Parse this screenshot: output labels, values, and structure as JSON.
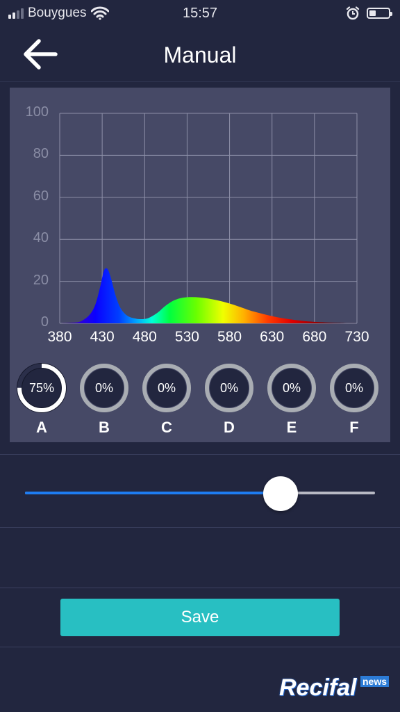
{
  "status_bar": {
    "carrier": "Bouygues",
    "time": "15:57",
    "battery_level": 0.35
  },
  "nav": {
    "title": "Manual",
    "back_icon": "arrow-left-icon"
  },
  "chart_data": {
    "type": "area",
    "title": "",
    "xlabel": "",
    "ylabel": "",
    "xlim": [
      380,
      730
    ],
    "ylim": [
      0,
      100
    ],
    "x_ticks": [
      "380",
      "430",
      "480",
      "530",
      "580",
      "630",
      "680",
      "730"
    ],
    "y_ticks": [
      "100",
      "80",
      "60",
      "40",
      "20",
      "0"
    ],
    "grid": true,
    "fill": "visible-spectrum-gradient",
    "series": [
      {
        "x": [
          380,
          395,
          405,
          415,
          422,
          428,
          432,
          436,
          440,
          446,
          452,
          460,
          470,
          478,
          485,
          495,
          505,
          515,
          525,
          535,
          545,
          555,
          565,
          575,
          585,
          595,
          605,
          620,
          635,
          650,
          665,
          680,
          700,
          715,
          730
        ],
        "y": [
          0,
          0.3,
          1,
          4,
          9,
          18,
          25,
          26,
          22,
          13,
          7,
          3.5,
          2.2,
          2,
          2.6,
          5,
          8.5,
          11,
          12.2,
          12.5,
          12.3,
          11.8,
          11,
          10,
          8.8,
          7.4,
          6,
          4.4,
          3,
          2,
          1.2,
          0.7,
          0.3,
          0.1,
          0
        ]
      }
    ]
  },
  "channels": [
    {
      "label": "A",
      "percent_text": "75%",
      "value": 0.75,
      "active": true
    },
    {
      "label": "B",
      "percent_text": "0%",
      "value": 0,
      "active": false
    },
    {
      "label": "C",
      "percent_text": "0%",
      "value": 0,
      "active": false
    },
    {
      "label": "D",
      "percent_text": "0%",
      "value": 0,
      "active": false
    },
    {
      "label": "E",
      "percent_text": "0%",
      "value": 0,
      "active": false
    },
    {
      "label": "F",
      "percent_text": "0%",
      "value": 0,
      "active": false
    }
  ],
  "slider": {
    "value": 0.73
  },
  "save_label": "Save",
  "watermark": {
    "main": "Recifal",
    "badge": "news"
  },
  "colors": {
    "background": "#22263f",
    "panel": "#464966",
    "accent": "#28bfc2",
    "slider_fill": "#1e7cf2"
  }
}
